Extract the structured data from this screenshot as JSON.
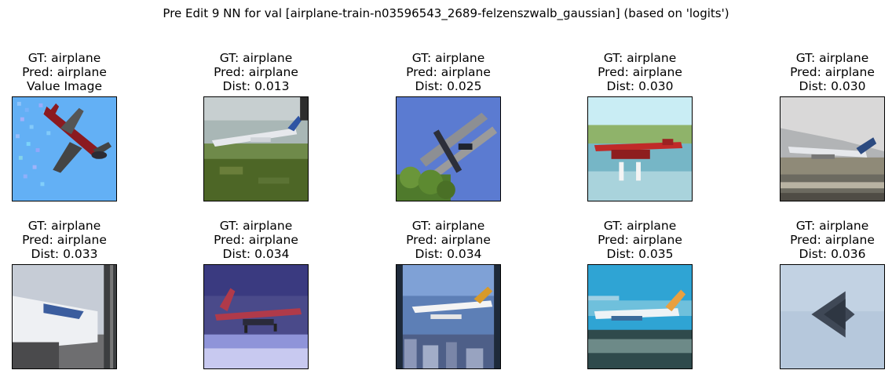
{
  "figure": {
    "title": "Pre Edit 9 NN for val [airplane-train-n03596543_2689-felzenszwalb_gaussian] (based on 'logits')"
  },
  "panels": [
    {
      "gt": "GT: airplane",
      "pred": "Pred: airplane",
      "extra": "Value Image",
      "scene": "query-jet-sky"
    },
    {
      "gt": "GT: airplane",
      "pred": "Pred: airplane",
      "extra": "Dist: 0.013",
      "scene": "jet-over-grass"
    },
    {
      "gt": "GT: airplane",
      "pred": "Pred: airplane",
      "extra": "Dist: 0.025",
      "scene": "biplane-blue-sky"
    },
    {
      "gt": "GT: airplane",
      "pred": "Pred: airplane",
      "extra": "Dist: 0.030",
      "scene": "floatplane-water"
    },
    {
      "gt": "GT: airplane",
      "pred": "Pred: airplane",
      "extra": "Dist: 0.030",
      "scene": "jet-landing-runway"
    },
    {
      "gt": "GT: airplane",
      "pred": "Pred: airplane",
      "extra": "Dist: 0.033",
      "scene": "jet-at-gate"
    },
    {
      "gt": "GT: airplane",
      "pred": "Pred: airplane",
      "extra": "Dist: 0.034",
      "scene": "red-jet-purple-sky"
    },
    {
      "gt": "GT: airplane",
      "pred": "Pred: airplane",
      "extra": "Dist: 0.034",
      "scene": "seaplane-over-city"
    },
    {
      "gt": "GT: airplane",
      "pred": "Pred: airplane",
      "extra": "Dist: 0.035",
      "scene": "airliner-on-taxiway"
    },
    {
      "gt": "GT: airplane",
      "pred": "Pred: airplane",
      "extra": "Dist: 0.036",
      "scene": "stealth-bomber-sky"
    }
  ]
}
